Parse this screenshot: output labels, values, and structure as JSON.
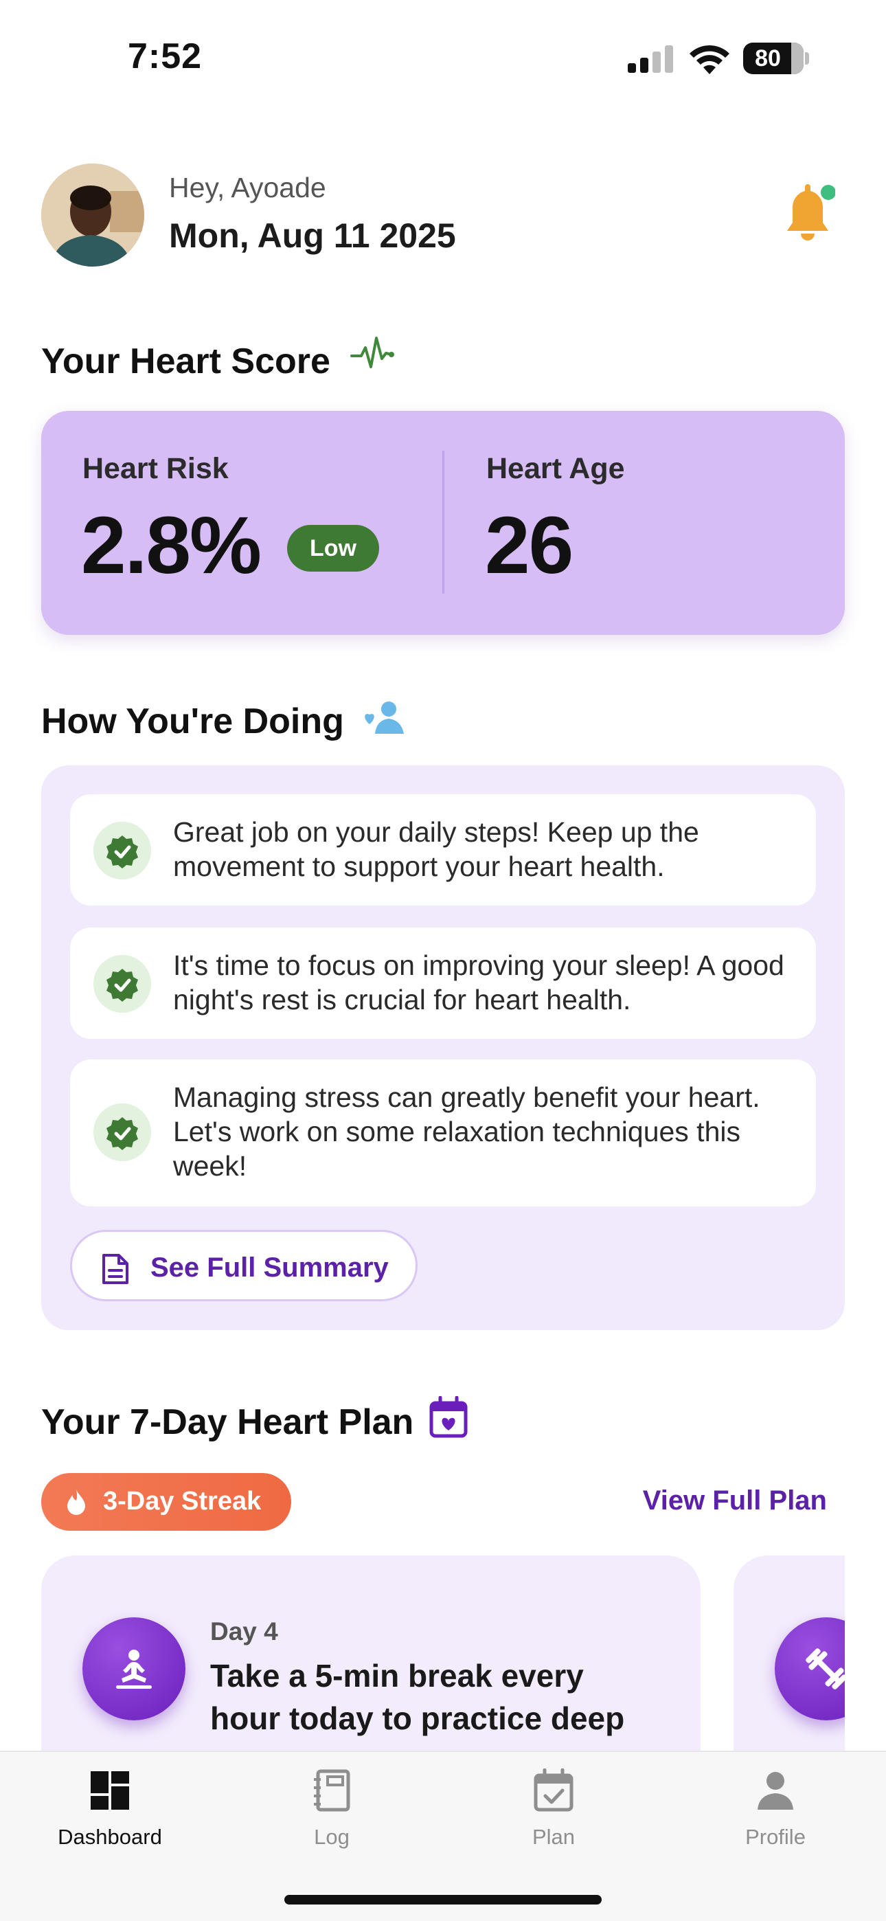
{
  "status_bar": {
    "time": "7:52",
    "battery": "80",
    "battery_level": 0.8
  },
  "header": {
    "greeting": "Hey, Ayoade",
    "date": "Mon, Aug 11 2025"
  },
  "heart_score": {
    "title": "Your Heart Score",
    "risk_label": "Heart Risk",
    "risk_value": "2.8%",
    "risk_badge": "Low",
    "age_label": "Heart Age",
    "age_value": "26"
  },
  "doing": {
    "title": "How You're Doing",
    "items": [
      {
        "text": "Great job on your daily steps! Keep up the movement to support your heart health."
      },
      {
        "text": "It's time to focus on improving your sleep! A good night's rest is crucial for heart health."
      },
      {
        "text": "Managing stress can greatly benefit your heart. Let's work on some relaxation techniques this week!"
      }
    ],
    "summary_button": "See Full Summary"
  },
  "plan": {
    "title": "Your 7-Day Heart Plan",
    "streak": "3-Day Streak",
    "view_full": "View Full Plan",
    "cards": [
      {
        "day": "Day 4",
        "text": "Take a 5-min break every hour today to practice deep",
        "icon": "meditation-icon"
      },
      {
        "icon": "dumbbell-icon"
      }
    ]
  },
  "tabs": [
    {
      "label": "Dashboard",
      "icon": "dashboard-icon",
      "active": true
    },
    {
      "label": "Log",
      "icon": "notebook-icon",
      "active": false
    },
    {
      "label": "Plan",
      "icon": "calendar-check-icon",
      "active": false
    },
    {
      "label": "Profile",
      "icon": "person-icon",
      "active": false
    }
  ],
  "colors": {
    "accent": "#5b21a6",
    "score_card": "#d6bdf6",
    "badge_low": "#3f7a35",
    "streak": "#ef6a43",
    "bell": "#f0a431",
    "notification_dot": "#3fbf7f"
  }
}
